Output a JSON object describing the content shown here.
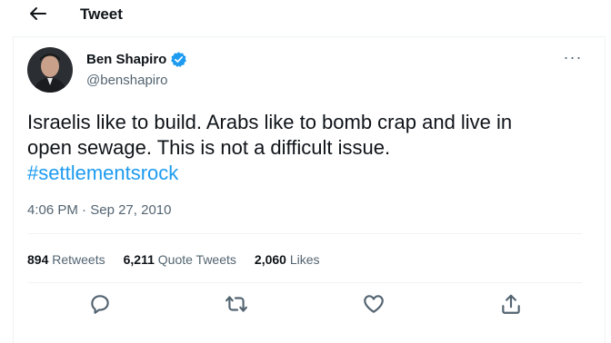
{
  "header": {
    "title": "Tweet"
  },
  "author": {
    "name": "Ben Shapiro",
    "handle": "@benshapiro",
    "verified": true
  },
  "tweet": {
    "line1": "Israelis like to build. Arabs like to bomb crap and live in",
    "line2": "open sewage. This is not a difficult issue.",
    "hashtag": "#settlementsrock",
    "time": "4:06 PM",
    "separator": "·",
    "date": "Sep 27, 2010"
  },
  "stats": {
    "retweets_count": "894",
    "retweets_label": "Retweets",
    "quotes_count": "6,211",
    "quotes_label": "Quote Tweets",
    "likes_count": "2,060",
    "likes_label": "Likes"
  },
  "more_label": "···",
  "colors": {
    "accent": "#1d9bf0",
    "text": "#0f1419",
    "secondary": "#536471",
    "border": "#eff3f4"
  },
  "icons": [
    "back-arrow-icon",
    "verified-badge-icon",
    "more-icon",
    "reply-icon",
    "retweet-icon",
    "like-icon",
    "share-icon"
  ]
}
